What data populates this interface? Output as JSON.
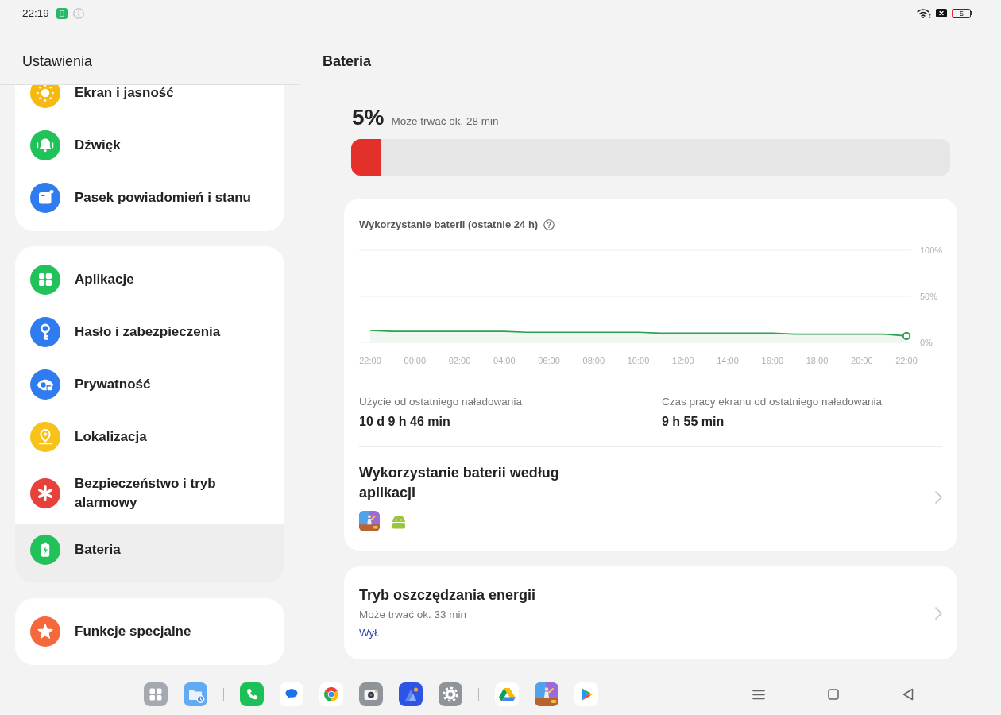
{
  "status_bar": {
    "time": "22:19",
    "battery_text": "5"
  },
  "sidebar": {
    "title": "Ustawienia",
    "groups": [
      {
        "items": [
          {
            "label": "Ekran i jasność",
            "color": "#f6b90f",
            "selected": false
          },
          {
            "label": "Dźwięk",
            "color": "#22c25a",
            "selected": false
          },
          {
            "label": "Pasek powiadomień i stanu",
            "color": "#2f7bf0",
            "selected": false
          }
        ]
      },
      {
        "items": [
          {
            "label": "Aplikacje",
            "color": "#22c25a",
            "selected": false
          },
          {
            "label": "Hasło i zabezpieczenia",
            "color": "#2f7bf0",
            "selected": false
          },
          {
            "label": "Prywatność",
            "color": "#2f7bf0",
            "selected": false
          },
          {
            "label": "Lokalizacja",
            "color": "#f7c21a",
            "selected": false
          },
          {
            "label": "Bezpieczeństwo i tryb alarmowy",
            "color": "#e8413b",
            "selected": false
          },
          {
            "label": "Bateria",
            "color": "#22c25a",
            "selected": true
          }
        ]
      },
      {
        "items": [
          {
            "label": "Funkcje specjalne",
            "color": "#f4683c",
            "selected": false
          }
        ]
      }
    ]
  },
  "page": {
    "title": "Bateria"
  },
  "battery": {
    "percent": "5%",
    "estimate": "Może trwać ok. 28 min",
    "level": 0.05
  },
  "usage_card": {
    "title": "Wykorzystanie baterii (ostatnie 24 h)",
    "chart_data": {
      "type": "area",
      "categories": [
        "22:00",
        null,
        "00:00",
        null,
        "02:00",
        null,
        "04:00",
        null,
        "06:00",
        null,
        "08:00",
        null,
        "10:00",
        null,
        "12:00",
        null,
        "14:00",
        null,
        "16:00",
        null,
        "18:00",
        null,
        "20:00",
        null,
        "22:00"
      ],
      "series": [
        {
          "color": "#2e9e4f",
          "values": [
            13,
            12,
            12,
            12,
            12,
            12,
            12,
            11,
            11,
            11,
            11,
            11,
            11,
            10,
            10,
            10,
            10,
            10,
            10,
            9,
            9,
            9,
            9,
            9,
            7
          ]
        }
      ],
      "ylim": [
        0,
        100
      ],
      "yticks": [
        {
          "value": 0,
          "label": "0%"
        },
        {
          "value": 50,
          "label": "50%"
        },
        {
          "value": 100,
          "label": "100%"
        }
      ]
    },
    "stats": [
      {
        "label": "Użycie od ostatniego naładowania",
        "value": "10 d 9 h 46 min"
      },
      {
        "label": "Czas pracy ekranu od ostatniego naładowania",
        "value": "9 h 55 min"
      }
    ],
    "by_app": {
      "title": "Wykorzystanie baterii według aplikacji"
    }
  },
  "power_saving": {
    "title": "Tryb oszczędzania energii",
    "estimate": "Może trwać ok. 33 min",
    "status": "Wył."
  }
}
